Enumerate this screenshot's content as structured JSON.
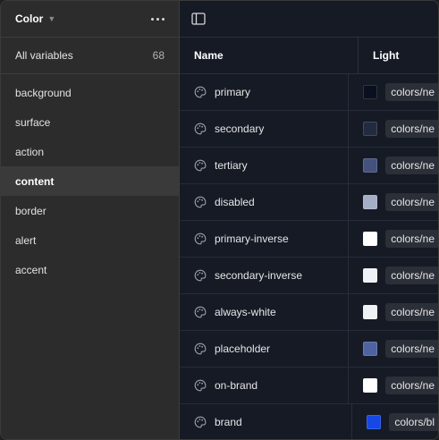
{
  "sidebar": {
    "collection": "Color",
    "all_variables": {
      "label": "All variables",
      "count": "68"
    },
    "groups": [
      {
        "label": "background",
        "active": false
      },
      {
        "label": "surface",
        "active": false
      },
      {
        "label": "action",
        "active": false
      },
      {
        "label": "content",
        "active": true
      },
      {
        "label": "border",
        "active": false
      },
      {
        "label": "alert",
        "active": false
      },
      {
        "label": "accent",
        "active": false
      }
    ]
  },
  "table": {
    "columns": {
      "name": "Name",
      "mode": "Light"
    },
    "rows": [
      {
        "name": "primary",
        "value": "colors/ne",
        "swatch": "#0b1020"
      },
      {
        "name": "secondary",
        "value": "colors/ne",
        "swatch": "#222b3f"
      },
      {
        "name": "tertiary",
        "value": "colors/ne",
        "swatch": "#44527d"
      },
      {
        "name": "disabled",
        "value": "colors/ne",
        "swatch": "#a4aec6"
      },
      {
        "name": "primary-inverse",
        "value": "colors/ne",
        "swatch": "#ffffff"
      },
      {
        "name": "secondary-inverse",
        "value": "colors/ne",
        "swatch": "#eef1f6"
      },
      {
        "name": "always-white",
        "value": "colors/ne",
        "swatch": "#eef1f6"
      },
      {
        "name": "placeholder",
        "value": "colors/ne",
        "swatch": "#4f63a0"
      },
      {
        "name": "on-brand",
        "value": "colors/ne",
        "swatch": "#ffffff"
      },
      {
        "name": "brand",
        "value": "colors/bl",
        "swatch": "#1648e6"
      }
    ]
  },
  "icons": {
    "chevron": "chevron-down-icon",
    "more": "more-horizontal-icon",
    "toggle": "sidebar-toggle-icon",
    "variable": "color-variable-icon"
  }
}
